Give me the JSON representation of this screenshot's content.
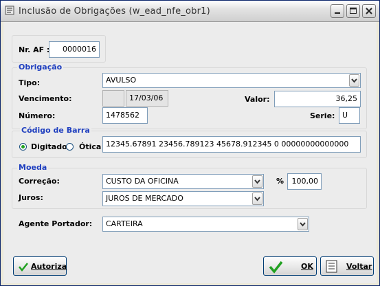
{
  "window": {
    "title": "Inclusão de Obrigações (w_ead_nfe_obr1)"
  },
  "af": {
    "label": "Nr. AF :",
    "value": "0000016"
  },
  "obrigacao": {
    "section_title": "Obrigação",
    "tipo_label": "Tipo:",
    "tipo_value": "AVULSO",
    "vencimento_label": "Vencimento:",
    "vencimento_value": "17/03/06",
    "valor_label": "Valor:",
    "valor_value": "36,25",
    "numero_label": "Número:",
    "numero_value": "1478562",
    "serie_label": "Serie:",
    "serie_value": "U"
  },
  "codigo_barra": {
    "section_title": "Código de Barra",
    "options": [
      {
        "label": "Digitado",
        "selected": true
      },
      {
        "label": "Ótica",
        "selected": false
      }
    ],
    "value": "12345.67891 23456.789123 45678.912345 0 00000000000000"
  },
  "moeda": {
    "section_title": "Moeda",
    "correcao_label": "Correção:",
    "correcao_value": "CUSTO DA OFICINA",
    "percent_label": "%",
    "percent_value": "100,00",
    "juros_label": "Juros:",
    "juros_value": "JUROS DE MERCADO"
  },
  "agente": {
    "label": "Agente Portador:",
    "value": "CARTEIRA"
  },
  "buttons": {
    "autoriza": "Autoriza",
    "ok": "OK",
    "voltar": "Voltar"
  },
  "colors": {
    "section_title": "#1f3fbf",
    "check_green": "#21a121",
    "border": "#7f9db9"
  }
}
